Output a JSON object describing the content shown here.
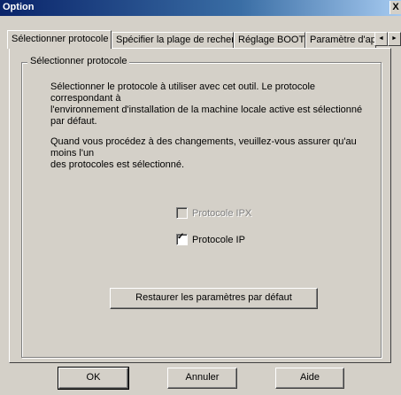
{
  "window": {
    "title": "Option",
    "close_label": "X"
  },
  "tabs": [
    {
      "label": "Sélectionner protocole"
    },
    {
      "label": "Spécifier la plage de recherche"
    },
    {
      "label": "Réglage BOOTP"
    },
    {
      "label": "Paramètre d'appe"
    }
  ],
  "tab_scroll": {
    "left": "◄",
    "right": "►"
  },
  "group": {
    "title": "Sélectionner protocole",
    "para1_line1": "Sélectionner le protocole à utiliser avec cet outil. Le protocole correspondant à",
    "para1_line2": "l'environnement d'installation de la machine locale active est sélectionné par défaut.",
    "para2_line1": "Quand vous procédez à des changements, veuillez-vous assurer qu'au moins l'un",
    "para2_line2": "des protocoles est sélectionné."
  },
  "checks": {
    "ipx": {
      "label": "Protocole IPX",
      "checked": false,
      "enabled": false
    },
    "ip": {
      "label": "Protocole IP",
      "checked": true,
      "enabled": true,
      "mark": "✓"
    }
  },
  "buttons": {
    "restore": "Restaurer les paramètres par défaut",
    "ok": "OK",
    "cancel": "Annuler",
    "help": "Aide"
  }
}
